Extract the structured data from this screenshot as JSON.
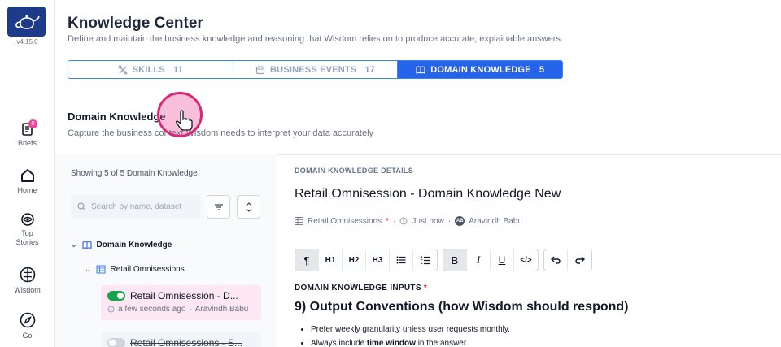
{
  "app": {
    "version": "v4.15.0"
  },
  "sidebar": {
    "items": [
      {
        "label": "Briefs",
        "badge": "0"
      },
      {
        "label": "Home"
      },
      {
        "label": "Top Stories"
      },
      {
        "label": "Wisdom"
      },
      {
        "label": "Go"
      }
    ]
  },
  "header": {
    "title": "Knowledge Center",
    "subtitle": "Define and maintain the business knowledge and reasoning that Wisdom relies on to produce accurate, explainable answers."
  },
  "tabs": [
    {
      "label": "SKILLS",
      "count": "11",
      "icon": "skills-icon"
    },
    {
      "label": "BUSINESS EVENTS",
      "count": "17",
      "icon": "calendar-icon"
    },
    {
      "label": "DOMAIN KNOWLEDGE",
      "count": "5",
      "icon": "book-icon",
      "active": true
    }
  ],
  "section": {
    "title": "Domain Knowledge",
    "subtitle": "Capture the business context Wisdom needs to interpret your data accurately"
  },
  "list": {
    "showing": "Showing 5 of 5 Domain Knowledge",
    "search_placeholder": "Search by name, dataset",
    "tree_root": "Domain Knowledge",
    "tree_dataset": "Retail Omnisessions",
    "items": [
      {
        "title": "Retail Omnisession - D...",
        "time": "a few seconds ago",
        "author": "Aravindh Babu",
        "enabled": true
      },
      {
        "title": "Retail Omnisessions - S...",
        "enabled": false
      }
    ]
  },
  "details": {
    "label": "DOMAIN KNOWLEDGE DETAILS",
    "title": "Retail Omnisession - Domain Knowledge New",
    "dataset": "Retail Omnisessions",
    "required_mark": "*",
    "updated": "Just now",
    "author_initials": "AB",
    "author": "Aravindh Babu",
    "toolbar": [
      "¶",
      "H1",
      "H2",
      "H3",
      "bulleted-list",
      "numbered-list",
      "B",
      "I",
      "U",
      "</>",
      "undo",
      "redo"
    ],
    "inputs_label": "DOMAIN KNOWLEDGE INPUTS",
    "content_heading": "9) Output Conventions (how Wisdom should respond)",
    "bullets": [
      "Prefer weekly granularity unless user requests monthly.",
      "Always include time window in the answer."
    ]
  },
  "colors": {
    "accent": "#2563eb",
    "brand": "#1e3a8a",
    "active_card": "#fce7f3",
    "toggle_on": "#16a34a",
    "required": "#e11d48"
  }
}
